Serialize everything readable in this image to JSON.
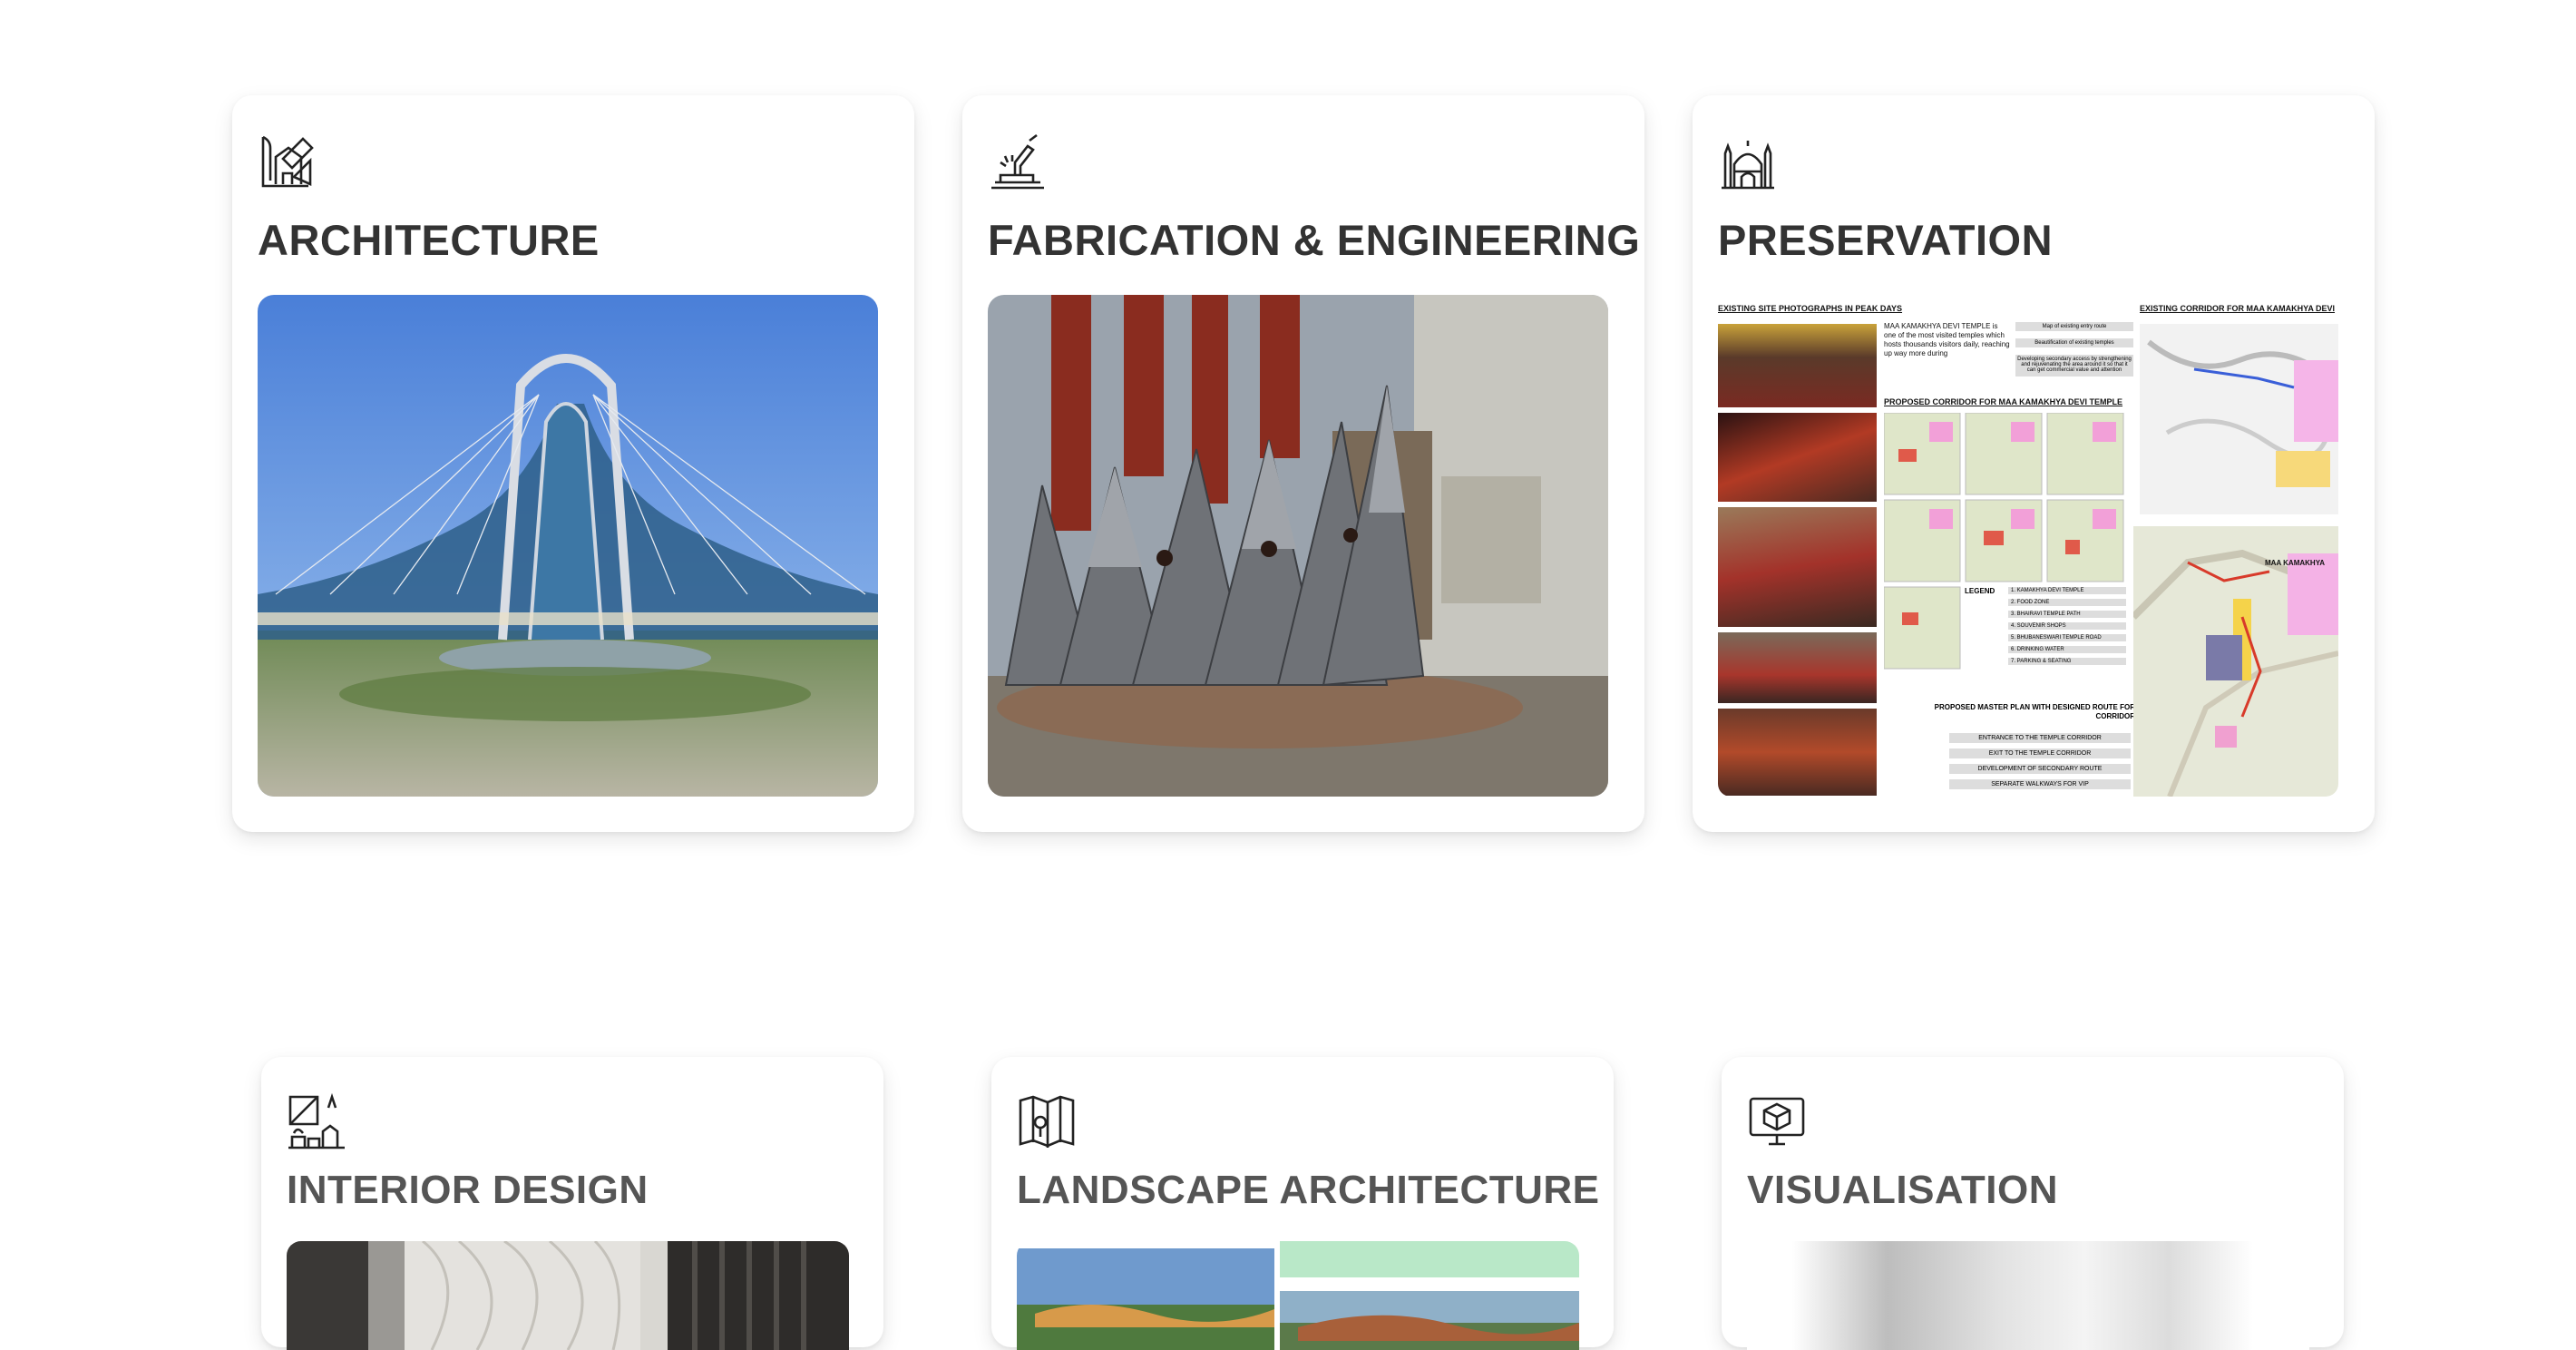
{
  "services": [
    {
      "title": "ARCHITECTURE",
      "icon": "blueprint-house-icon"
    },
    {
      "title": "FABRICATION & ENGINEERING",
      "icon": "welding-icon"
    },
    {
      "title": "PRESERVATION",
      "icon": "mosque-icon"
    },
    {
      "title": "INTERIOR DESIGN",
      "icon": "interior-furniture-icon"
    },
    {
      "title": "LANDSCAPE ARCHITECTURE",
      "icon": "landscape-map-icon"
    },
    {
      "title": "VISUALISATION",
      "icon": "3d-monitor-icon"
    }
  ],
  "preservation_sheet": {
    "heading_left": "EXISTING SITE PHOTOGRAPHS IN PEAK DAYS",
    "heading_right": "EXISTING CORRIDOR FOR MAA KAMAKHYA DEVI",
    "intro": "MAA KAMAKHYA DEVI TEMPLE is one of the most visited temples which hosts thousands visitors daily, reaching up way more during",
    "notes": [
      "Map of existing entry route",
      "Beautification of existing temples",
      "Developing secondary access by strengthening and rejuvenating the area around it so that it can get commercial value and attention"
    ],
    "corridor_heading": "PROPOSED CORRIDOR FOR MAA KAMAKHYA DEVI TEMPLE",
    "legend_title": "LEGEND",
    "legend_items": [
      "1. KAMAKHYA DEVI TEMPLE",
      "2. FOOD ZONE",
      "3. BHAIRAVI TEMPLE PATH",
      "4. SOUVENIR SHOPS",
      "5. BHUBANESWARI TEMPLE ROAD",
      "6. DRINKING WATER",
      "7. PARKING & SEATING"
    ],
    "master_plan_heading": "PROPOSED MASTER PLAN WITH DESIGNED ROUTE FOR CORRIDOR",
    "route_items": [
      "ENTRANCE TO THE TEMPLE CORRIDOR",
      "EXIT TO THE TEMPLE CORRIDOR",
      "DEVELOPMENT OF SECONDARY ROUTE",
      "SEPARATE WALKWAYS FOR VIP"
    ],
    "map_label": "MAA KAMAKHYA"
  }
}
